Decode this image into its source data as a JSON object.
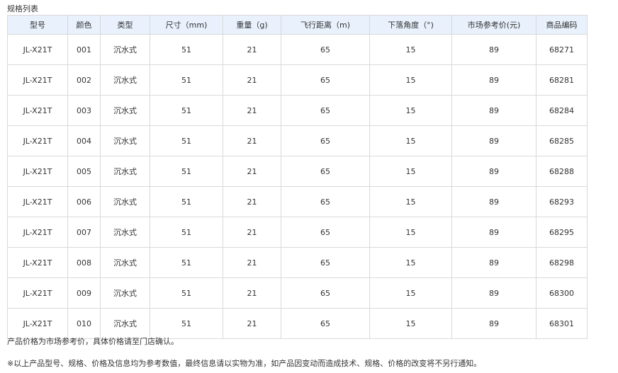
{
  "title": "规格列表",
  "columns": [
    "型号",
    "颜色",
    "类型",
    "尺寸（mm)",
    "重量（g)",
    "飞行距离（m)",
    "下落角度（°)",
    "市场参考价(元)",
    "商品编码"
  ],
  "rows": [
    [
      "JL-X21T",
      "001",
      "沉水式",
      "51",
      "21",
      "65",
      "15",
      "89",
      "68271"
    ],
    [
      "JL-X21T",
      "002",
      "沉水式",
      "51",
      "21",
      "65",
      "15",
      "89",
      "68281"
    ],
    [
      "JL-X21T",
      "003",
      "沉水式",
      "51",
      "21",
      "65",
      "15",
      "89",
      "68284"
    ],
    [
      "JL-X21T",
      "004",
      "沉水式",
      "51",
      "21",
      "65",
      "15",
      "89",
      "68285"
    ],
    [
      "JL-X21T",
      "005",
      "沉水式",
      "51",
      "21",
      "65",
      "15",
      "89",
      "68288"
    ],
    [
      "JL-X21T",
      "006",
      "沉水式",
      "51",
      "21",
      "65",
      "15",
      "89",
      "68293"
    ],
    [
      "JL-X21T",
      "007",
      "沉水式",
      "51",
      "21",
      "65",
      "15",
      "89",
      "68295"
    ],
    [
      "JL-X21T",
      "008",
      "沉水式",
      "51",
      "21",
      "65",
      "15",
      "89",
      "68298"
    ],
    [
      "JL-X21T",
      "009",
      "沉水式",
      "51",
      "21",
      "65",
      "15",
      "89",
      "68300"
    ],
    [
      "JL-X21T",
      "010",
      "沉水式",
      "51",
      "21",
      "65",
      "15",
      "89",
      "68301"
    ]
  ],
  "notes": [
    "产品价格为市场参考价，具体价格请至门店确认。",
    "※以上产品型号、规格、价格及信息均为参考数值，最终信息请以实物为准，如产品因变动而造成技术、规格、价格的改变将不另行通知。"
  ],
  "colors": {
    "header_bg": "#e8f1fc",
    "border": "#d9d9d9",
    "text": "#333333"
  }
}
